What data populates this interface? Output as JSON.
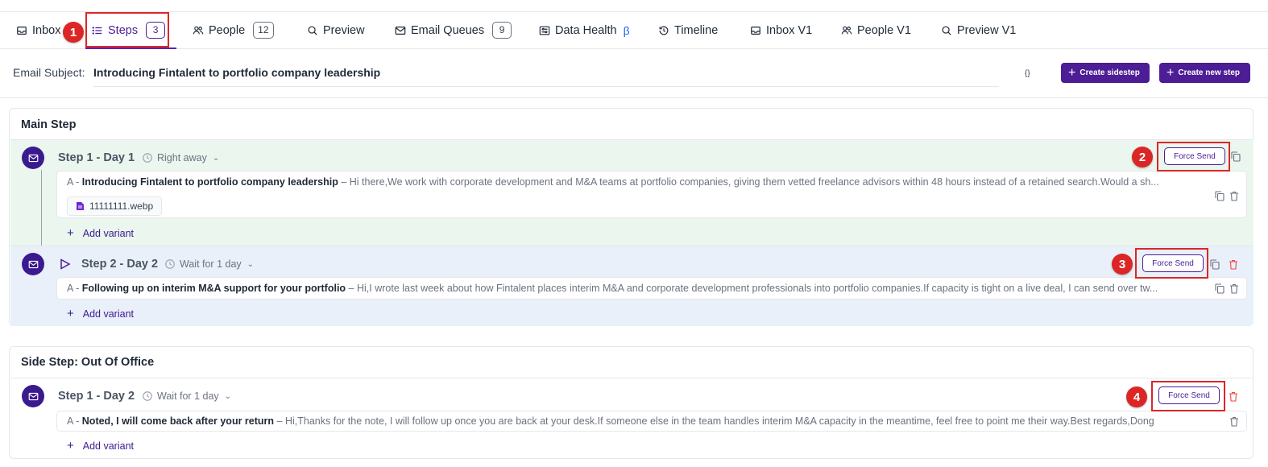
{
  "tabs": [
    {
      "label": "Inbox",
      "icon": "inbox-icon"
    },
    {
      "label": "Steps",
      "icon": "list-icon",
      "badge": "3",
      "active": true
    },
    {
      "label": "People",
      "icon": "people-icon",
      "badge": "12"
    },
    {
      "label": "Preview",
      "icon": "search-icon"
    },
    {
      "label": "Email Queues",
      "icon": "mail-icon",
      "badge": "9"
    },
    {
      "label": "Data Health",
      "icon": "sliders-icon",
      "suffix": "β"
    },
    {
      "label": "Timeline",
      "icon": "history-icon"
    },
    {
      "label": "Inbox V1",
      "icon": "inbox-icon"
    },
    {
      "label": "People V1",
      "icon": "people-icon"
    },
    {
      "label": "Preview V1",
      "icon": "search-icon"
    }
  ],
  "annotations": [
    "1",
    "2",
    "3",
    "4"
  ],
  "subject": {
    "label": "Email Subject:",
    "value": "Introducing Fintalent to portfolio company leadership",
    "braces": "{}",
    "create_sidestep": "Create sidestep",
    "create_new_step": "Create new step"
  },
  "main": {
    "title": "Main Step",
    "steps": [
      {
        "title": "Step 1 - Day 1",
        "timing": "Right away",
        "force_send": "Force Send",
        "variant": {
          "prefix": "A -",
          "subject": "Introducing Fintalent to portfolio company leadership",
          "separator": "–",
          "body": "Hi there,We work with corporate development and M&A teams at portfolio companies, giving them vetted freelance advisors within 48 hours instead of a retained search.Would a sh..."
        },
        "attachment": "11111111.webp",
        "add_variant": "Add variant"
      },
      {
        "title": "Step 2 - Day 2",
        "timing": "Wait for 1 day",
        "force_send": "Force Send",
        "variant": {
          "prefix": "A -",
          "subject": "Following up on interim M&A support for your portfolio",
          "separator": "–",
          "body": "Hi,I wrote last week about how Fintalent places interim M&A and corporate development professionals into portfolio companies.If capacity is tight on a live deal, I can send over tw..."
        },
        "add_variant": "Add variant"
      }
    ]
  },
  "side": {
    "title": "Side Step: Out Of Office",
    "steps": [
      {
        "title": "Step 1 - Day 2",
        "timing": "Wait for 1 day",
        "force_send": "Force Send",
        "variant": {
          "prefix": "A -",
          "subject": "Noted, I will come back after your return",
          "separator": "–",
          "body": "Hi,Thanks for the note, I will follow up once you are back at your desk.If someone else in the team handles interim M&A capacity in the meantime, feel free to point me their way.Best regards,Dong"
        },
        "add_variant": "Add variant"
      }
    ]
  },
  "colors": {
    "brand": "#4c1d95",
    "annotation": "#dc2626",
    "step1_bg": "#eaf6ee",
    "step2_bg": "#e9f0f9",
    "delete_red": "#ef4444"
  }
}
